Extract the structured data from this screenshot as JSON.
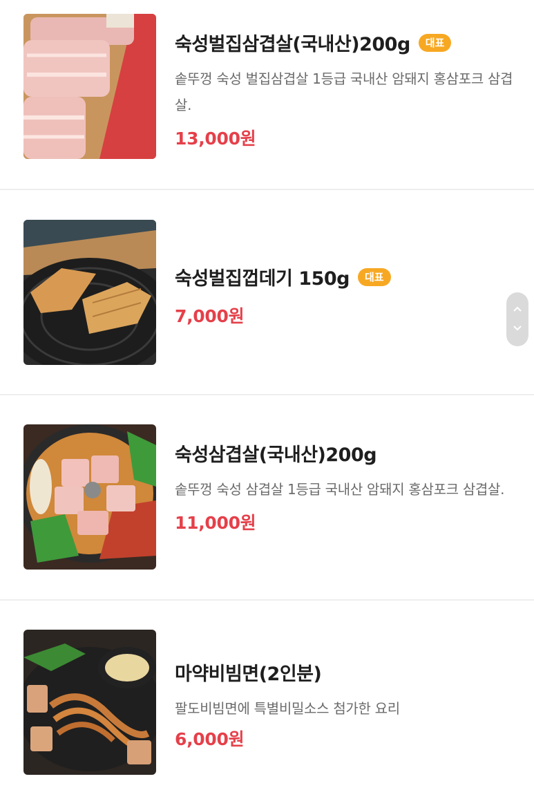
{
  "menu": {
    "items": [
      {
        "name": "숙성벌집삼겹살(국내산)200g",
        "badge": "대표",
        "description": "솥뚜껑 숙성 벌집삼겹살 1등급 국내산 암돼지 홍삼포크 삼겹살.",
        "price": "13,000원",
        "image": "raw-pork-belly-photo"
      },
      {
        "name": "숙성벌집껍데기 150g",
        "badge": "대표",
        "description": "",
        "price": "7,000원",
        "image": "grilled-pork-skin-photo"
      },
      {
        "name": "숙성삼겹살(국내산)200g",
        "badge": "",
        "description": "솥뚜껑 숙성 삼겹살 1등급 국내산 암돼지 홍삼포크 삼겹살.",
        "price": "11,000원",
        "image": "pork-belly-on-lid-photo"
      },
      {
        "name": "마약비빔면(2인분)",
        "badge": "",
        "description": "팔도비빔면에 특별비밀소스 첨가한 요리",
        "price": "6,000원",
        "image": "bibim-noodles-photo"
      }
    ]
  },
  "scroll": {
    "up_icon": "chevron-up-icon",
    "down_icon": "chevron-down-icon"
  },
  "colors": {
    "price": "#e5404a",
    "badge": "#f7a823"
  }
}
